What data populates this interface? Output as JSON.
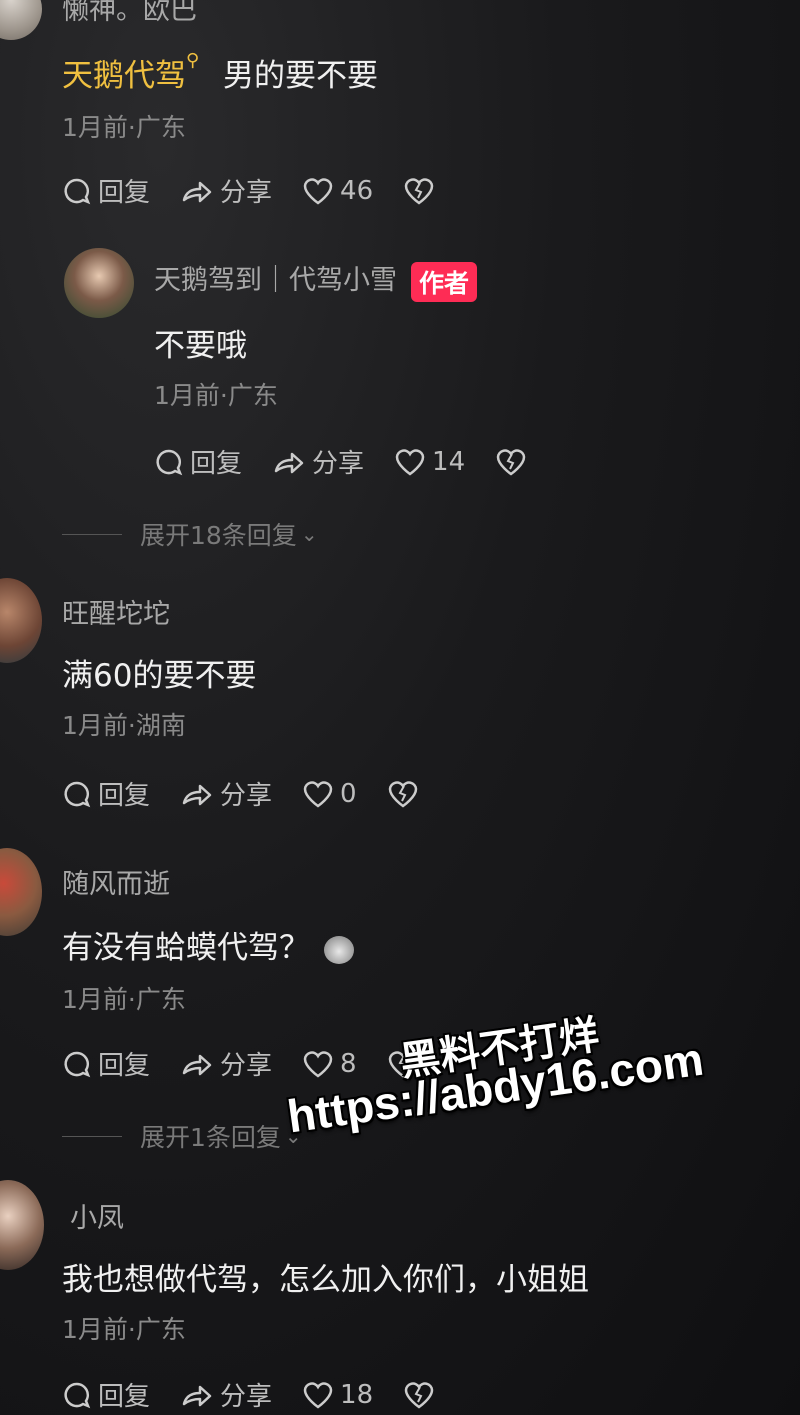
{
  "comments": [
    {
      "username": "懒神。欧巴",
      "mention": "天鹅代驾",
      "text": "男的要不要",
      "meta": "1月前·广东",
      "reply": "回复",
      "share": "分享",
      "likes": "46"
    },
    {
      "username": "天鹅驾到｜代驾小雪",
      "author_badge": "作者",
      "text": "不要哦",
      "meta": "1月前·广东",
      "reply": "回复",
      "share": "分享",
      "likes": "14",
      "expand": "展开18条回复"
    },
    {
      "username": "旺醒坨坨",
      "text": "满60的要不要",
      "meta": "1月前·湖南",
      "reply": "回复",
      "share": "分享",
      "likes": "0"
    },
    {
      "username": "随风而逝",
      "text": "有没有蛤蟆代驾？",
      "meta": "1月前·广东",
      "reply": "回复",
      "share": "分享",
      "likes": "8",
      "expand": "展开1条回复"
    },
    {
      "username": "小凤",
      "text": "我也想做代驾，怎么加入你们，小姐姐",
      "meta": "1月前·广东",
      "reply": "回复",
      "share": "分享",
      "likes": "18"
    }
  ],
  "watermark": {
    "line1": "黑料不打烊",
    "line2": "https://abdy16.com"
  }
}
